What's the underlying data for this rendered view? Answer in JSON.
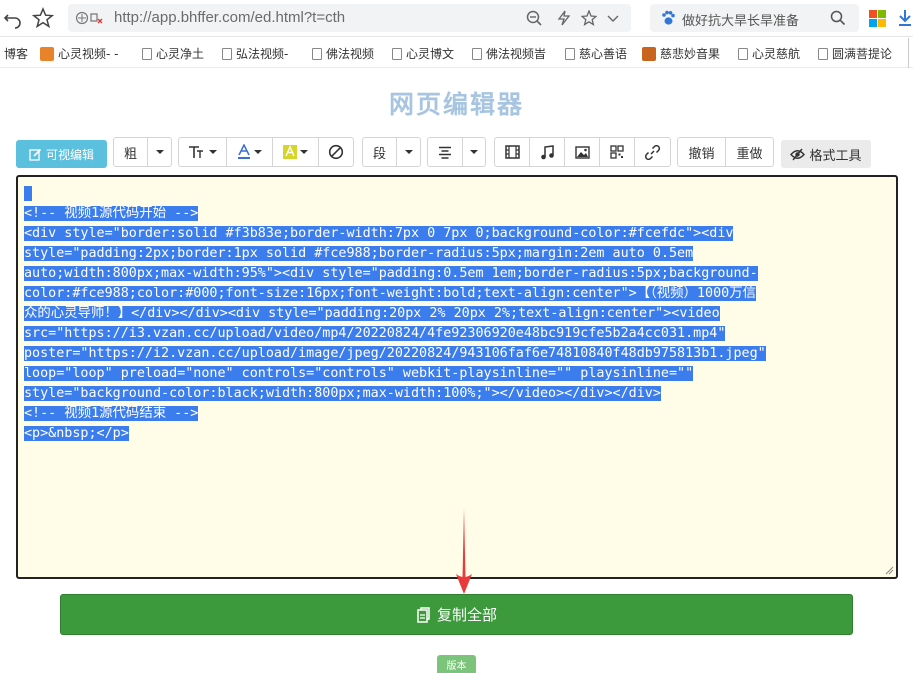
{
  "browser": {
    "url": "http://app.bhffer.com/ed.html?t=cth",
    "search_text": "做好抗大旱长旱准备",
    "bookmarks": [
      {
        "label": "博客",
        "icon": "none"
      },
      {
        "label": "心灵视频- -",
        "icon": "orange-favicon"
      },
      {
        "label": "心灵净土",
        "icon": "doc-icon"
      },
      {
        "label": "弘法视频-",
        "icon": "doc-icon"
      },
      {
        "label": "佛法视频",
        "icon": "doc-icon"
      },
      {
        "label": "心灵博文",
        "icon": "doc-icon"
      },
      {
        "label": "佛法视频旹",
        "icon": "doc-icon"
      },
      {
        "label": "慈心善语",
        "icon": "doc-icon"
      },
      {
        "label": "慈悲妙音果",
        "icon": "orange-favicon"
      },
      {
        "label": "心灵慈航",
        "icon": "doc-icon"
      },
      {
        "label": "圆满菩提论",
        "icon": "doc-icon"
      }
    ]
  },
  "page": {
    "title": "网页编辑器"
  },
  "toolbar": {
    "visual_edit_label": "可视编辑",
    "bold_label": "粗",
    "paragraph_label": "段",
    "undo_label": "撤销",
    "redo_label": "重做",
    "format_tool_label": "格式工具"
  },
  "editor": {
    "lines": [
      "<!-- 视频1源代码开始 -->",
      "<div style=\"border:solid #f3b83e;border-width:7px 0 7px 0;background-color:#fcefdc\"><div",
      "style=\"padding:2px;border:1px solid #fce988;border-radius:5px;margin:2em auto 0.5em",
      "auto;width:800px;max-width:95%\"><div style=\"padding:0.5em 1em;border-radius:5px;background-",
      "color:#fce988;color:#000;font-size:16px;font-weight:bold;text-align:center\">【（视频）1000万信",
      "众的心灵导师！】</div></div><div style=\"padding:20px 2% 20px 2%;text-align:center\"><video",
      "src=\"https://i3.vzan.cc/upload/video/mp4/20220824/4fe92306920e48bc919cfe5b2a4cc031.mp4\"",
      "poster=\"https://i2.vzan.cc/upload/image/jpeg/20220824/943106faf6e74810840f48db975813b1.jpeg\"",
      "loop=\"loop\" preload=\"none\" controls=\"controls\" webkit-playsinline=\"\" playsinline=\"\"",
      "style=\"background-color:black;width:800px;max-width:100%;\"></video></div></div>",
      "<!-- 视频1源代码结束 -->",
      "<p>&nbsp;</p>"
    ]
  },
  "copy_all_label": "复制全部",
  "version_label": "版本",
  "colors": {
    "title": "#a7c5e0",
    "visual_edit_bg": "#5bc0de",
    "editor_bg": "#fffde7",
    "selection": "#3b7ded",
    "copy_button": "#3c9a3c",
    "arrow": "#e83a3a"
  }
}
